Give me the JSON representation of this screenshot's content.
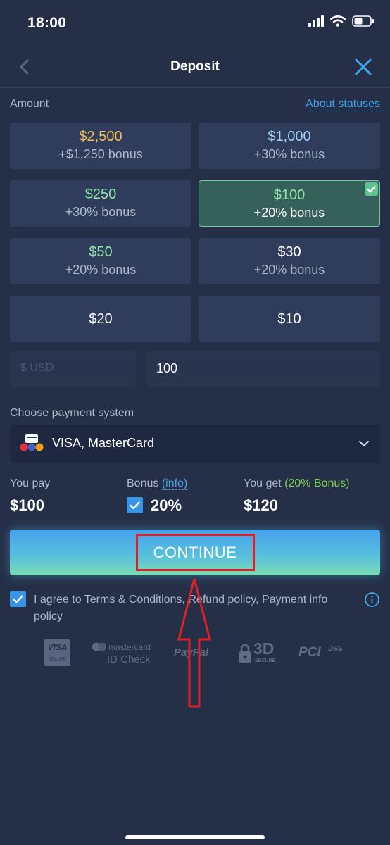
{
  "status_bar": {
    "time": "18:00"
  },
  "header": {
    "title": "Deposit"
  },
  "amount_section": {
    "label": "Amount",
    "about_link": "About statuses",
    "options": [
      {
        "amount": "$2,500",
        "bonus": "+$1,250 bonus",
        "amount_color": "#f2c14e",
        "selected": false
      },
      {
        "amount": "$1,000",
        "bonus": "+30% bonus",
        "amount_color": "#9fd0f5",
        "selected": false
      },
      {
        "amount": "$250",
        "bonus": "+30% bonus",
        "amount_color": "#8ee3a8",
        "selected": false
      },
      {
        "amount": "$100",
        "bonus": "+20% bonus",
        "amount_color": "#8ee3a8",
        "selected": true
      },
      {
        "amount": "$50",
        "bonus": "+20% bonus",
        "amount_color": "#8ee3a8",
        "selected": false
      },
      {
        "amount": "$30",
        "bonus": "+20% bonus",
        "amount_color": "#ffffff",
        "selected": false
      },
      {
        "amount": "$20",
        "bonus": "",
        "amount_color": "#ffffff",
        "selected": false
      },
      {
        "amount": "$10",
        "bonus": "",
        "amount_color": "#ffffff",
        "selected": false
      }
    ]
  },
  "amount_input": {
    "currency_placeholder": "$ USD",
    "value": "100"
  },
  "payment": {
    "label": "Choose payment system",
    "selected": "VISA, MasterCard"
  },
  "summary": {
    "you_pay_label": "You pay",
    "you_pay_value": "$100",
    "bonus_label": "Bonus",
    "bonus_info_link": "(info)",
    "bonus_value": "20%",
    "bonus_checked": true,
    "you_get_label": "You get",
    "you_get_note": "(20% Bonus)",
    "you_get_value": "$120"
  },
  "continue_button": {
    "label": "CONTINUE"
  },
  "agreement": {
    "text": "I agree to Terms & Conditions, Refund policy, Payment info policy",
    "checked": true
  },
  "trust_badges": {
    "visa_line1": "VISA",
    "visa_line2": "SECURE",
    "mastercard_line1": "mastercard",
    "mastercard_line2": "ID Check",
    "paypal": "PayPal",
    "secure3d_big": "3D",
    "secure3d_small": "SECURE",
    "pci": "PCI",
    "dss": "DSS"
  },
  "colors": {
    "background": "#252f48",
    "tile": "#2f3c5c",
    "tile_selected": "#36605a",
    "accent_blue": "#3fa5ec",
    "annotation_red": "#e01f27"
  }
}
